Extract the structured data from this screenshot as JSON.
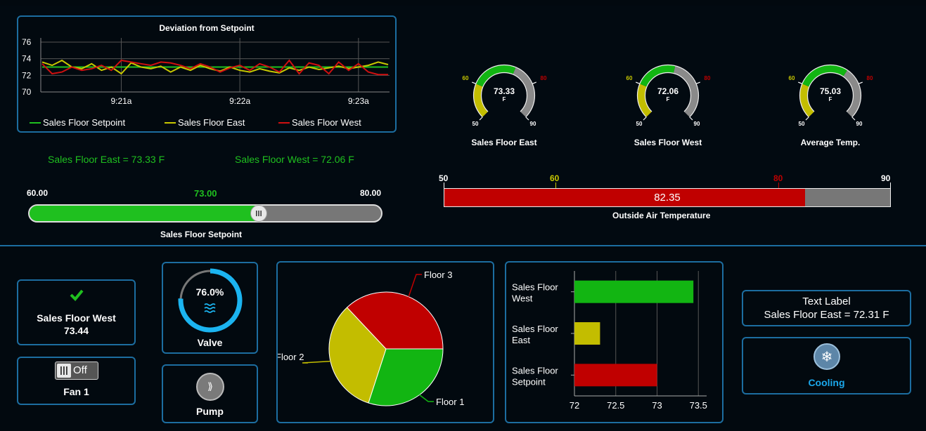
{
  "line_chart": {
    "title": "Deviation from Setpoint",
    "y_ticks": [
      "76",
      "74",
      "72",
      "70"
    ],
    "x_ticks": [
      "9:21a",
      "9:22a",
      "9:23a"
    ],
    "legend": [
      "Sales Floor Setpoint",
      "Sales Floor East",
      "Sales Floor West"
    ],
    "colors": {
      "setpoint": "#1fc01f",
      "east": "#c8c800",
      "west": "#d01010"
    }
  },
  "readouts": {
    "east": "Sales Floor East = 73.33 F",
    "west": "Sales Floor West = 72.06 F"
  },
  "setpoint_slider": {
    "min_label": "60.00",
    "value_label": "73.00",
    "max_label": "80.00",
    "label": "Sales Floor Setpoint",
    "min": 60,
    "max": 80,
    "value": 73
  },
  "gauges": [
    {
      "value": "73.33",
      "unit": "F",
      "low": "60",
      "high": "80",
      "min": "50",
      "max": "90",
      "label": "Sales Floor East",
      "v": 73.33
    },
    {
      "value": "72.06",
      "unit": "F",
      "low": "60",
      "high": "80",
      "min": "50",
      "max": "90",
      "label": "Sales Floor West",
      "v": 72.06
    },
    {
      "value": "75.03",
      "unit": "F",
      "low": "60",
      "high": "80",
      "min": "50",
      "max": "90",
      "label": "Average Temp.",
      "v": 75.03
    }
  ],
  "outside_air": {
    "ticks": [
      "50",
      "60",
      "80",
      "90"
    ],
    "value_label": "82.35",
    "label": "Outside Air Temperature",
    "min": 50,
    "max": 90,
    "value": 82.35
  },
  "status_tile": {
    "label": "Sales Floor West",
    "value": "73.44"
  },
  "fan": {
    "state": "Off",
    "label": "Fan 1"
  },
  "valve": {
    "percent": "76.0%",
    "label": "Valve",
    "fraction": 0.76
  },
  "pump": {
    "label": "Pump"
  },
  "text_tile": {
    "line1": "Text Label",
    "line2": "Sales Floor East = 72.31 F"
  },
  "cooling": {
    "label": "Cooling"
  },
  "chart_data": [
    {
      "type": "line",
      "title": "Deviation from Setpoint",
      "x": [
        "9:20:20",
        "9:20:25",
        "9:20:30",
        "9:20:35",
        "9:20:40",
        "9:20:45",
        "9:20:50",
        "9:20:55",
        "9:21:00",
        "9:21:05",
        "9:21:10",
        "9:21:15",
        "9:21:20",
        "9:21:25",
        "9:21:30",
        "9:21:35",
        "9:21:40",
        "9:21:45",
        "9:21:50",
        "9:21:55",
        "9:22:00",
        "9:22:05",
        "9:22:10",
        "9:22:15",
        "9:22:20",
        "9:22:25",
        "9:22:30",
        "9:22:35",
        "9:22:40",
        "9:22:45",
        "9:22:50",
        "9:22:55",
        "9:23:00",
        "9:23:05",
        "9:23:10",
        "9:23:15"
      ],
      "x_ticks": [
        "9:21a",
        "9:22a",
        "9:23a"
      ],
      "ylim": [
        70,
        76
      ],
      "y_ticks": [
        70,
        72,
        74,
        76
      ],
      "grid": true,
      "legend": "bottom",
      "series": [
        {
          "name": "Sales Floor Setpoint",
          "color": "#1fc01f",
          "values": [
            73,
            73,
            73,
            73,
            73,
            73,
            73,
            73,
            73,
            73,
            73,
            73,
            73,
            73,
            73,
            73,
            73,
            73,
            73,
            73,
            73,
            73,
            73,
            73,
            73,
            73,
            73,
            73,
            73,
            73,
            73,
            73,
            73,
            73,
            73,
            73
          ]
        },
        {
          "name": "Sales Floor East",
          "color": "#c8c800",
          "values": [
            73.6,
            73.2,
            73.8,
            73.0,
            72.8,
            73.4,
            72.6,
            73.0,
            72.2,
            73.5,
            73.0,
            72.8,
            73.1,
            72.4,
            73.0,
            72.6,
            73.2,
            72.8,
            72.5,
            73.0,
            72.6,
            72.4,
            72.8,
            72.5,
            72.3,
            72.9,
            72.6,
            73.0,
            72.7,
            72.9,
            73.1,
            72.8,
            73.0,
            73.2,
            73.6,
            73.3
          ]
        },
        {
          "name": "Sales Floor West",
          "color": "#d01010",
          "values": [
            73.4,
            72.2,
            72.4,
            73.0,
            72.6,
            72.8,
            73.2,
            72.6,
            73.8,
            73.6,
            73.4,
            73.2,
            73.6,
            73.5,
            73.2,
            72.8,
            73.4,
            73.0,
            72.4,
            72.9,
            73.2,
            72.6,
            73.4,
            73.0,
            72.4,
            73.8,
            72.2,
            73.5,
            73.2,
            72.2,
            73.6,
            72.6,
            73.4,
            72.4,
            72.1,
            72.1
          ]
        }
      ]
    },
    {
      "type": "pie",
      "categories": [
        "Floor 1",
        "Floor 2",
        "Floor 3"
      ],
      "values": [
        30,
        33,
        37
      ],
      "colors": [
        "#12b512",
        "#c3bd00",
        "#c00000"
      ]
    },
    {
      "type": "bar",
      "orientation": "horizontal",
      "categories": [
        "Sales Floor West",
        "Sales Floor East",
        "Sales Floor Setpoint"
      ],
      "category_lines": [
        [
          "Sales Floor",
          "West"
        ],
        [
          "Sales Floor",
          "East"
        ],
        [
          "Sales Floor",
          "Setpoint"
        ]
      ],
      "values": [
        73.44,
        72.31,
        73.0
      ],
      "colors": [
        "#12b512",
        "#c3bd00",
        "#c00000"
      ],
      "xlim": [
        72,
        73.6
      ],
      "x_ticks": [
        "72",
        "72.5",
        "73",
        "73.5"
      ],
      "grid": true
    }
  ]
}
